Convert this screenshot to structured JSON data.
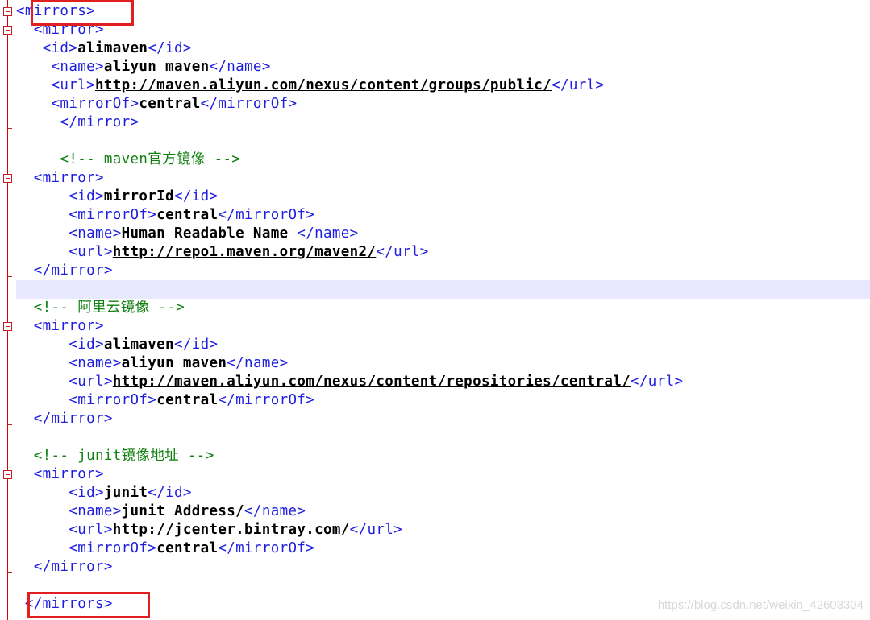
{
  "lines": [
    [
      {
        "t": "<mirrors>",
        "c": "tag"
      }
    ],
    [
      {
        "t": "  <mirror>",
        "c": "tag"
      }
    ],
    [
      {
        "t": "   <id>",
        "c": "tag"
      },
      {
        "t": "alimaven",
        "c": "val"
      },
      {
        "t": "</id>",
        "c": "tag"
      }
    ],
    [
      {
        "t": "    <name>",
        "c": "tag"
      },
      {
        "t": "aliyun maven",
        "c": "val"
      },
      {
        "t": "</name>",
        "c": "tag"
      }
    ],
    [
      {
        "t": "    <url>",
        "c": "tag"
      },
      {
        "t": "http://maven.aliyun.com/nexus/content/groups/public/",
        "c": "url"
      },
      {
        "t": "</url>",
        "c": "tag"
      }
    ],
    [
      {
        "t": "    <mirrorOf>",
        "c": "tag"
      },
      {
        "t": "central",
        "c": "val"
      },
      {
        "t": "</mirrorOf>",
        "c": "tag"
      }
    ],
    [
      {
        "t": "     </mirror>",
        "c": "tag"
      }
    ],
    [],
    [
      {
        "t": "     <!-- maven官方镜像 -->",
        "c": "cmt"
      }
    ],
    [
      {
        "t": "  <mirror>",
        "c": "tag"
      }
    ],
    [
      {
        "t": "      <id>",
        "c": "tag"
      },
      {
        "t": "mirrorId",
        "c": "val"
      },
      {
        "t": "</id>",
        "c": "tag"
      }
    ],
    [
      {
        "t": "      <mirrorOf>",
        "c": "tag"
      },
      {
        "t": "central",
        "c": "val"
      },
      {
        "t": "</mirrorOf>",
        "c": "tag"
      }
    ],
    [
      {
        "t": "      <name>",
        "c": "tag"
      },
      {
        "t": "Human Readable Name ",
        "c": "val"
      },
      {
        "t": "</name>",
        "c": "tag"
      }
    ],
    [
      {
        "t": "      <url>",
        "c": "tag"
      },
      {
        "t": "http://repo1.maven.org/maven2/",
        "c": "url"
      },
      {
        "t": "</url>",
        "c": "tag"
      }
    ],
    [
      {
        "t": "  </mirror>",
        "c": "tag"
      }
    ],
    [],
    [
      {
        "t": "  <!-- 阿里云镜像 -->",
        "c": "cmt"
      }
    ],
    [
      {
        "t": "  <mirror>",
        "c": "tag"
      }
    ],
    [
      {
        "t": "      <id>",
        "c": "tag"
      },
      {
        "t": "alimaven",
        "c": "val"
      },
      {
        "t": "</id>",
        "c": "tag"
      }
    ],
    [
      {
        "t": "      <name>",
        "c": "tag"
      },
      {
        "t": "aliyun maven",
        "c": "val"
      },
      {
        "t": "</name>",
        "c": "tag"
      }
    ],
    [
      {
        "t": "      <url>",
        "c": "tag"
      },
      {
        "t": "http://maven.aliyun.com/nexus/content/repositories/central/",
        "c": "url"
      },
      {
        "t": "</url>",
        "c": "tag"
      }
    ],
    [
      {
        "t": "      <mirrorOf>",
        "c": "tag"
      },
      {
        "t": "central",
        "c": "val"
      },
      {
        "t": "</mirrorOf>",
        "c": "tag"
      }
    ],
    [
      {
        "t": "  </mirror>",
        "c": "tag"
      }
    ],
    [],
    [
      {
        "t": "  <!-- junit镜像地址 -->",
        "c": "cmt"
      }
    ],
    [
      {
        "t": "  <mirror>",
        "c": "tag"
      }
    ],
    [
      {
        "t": "      <id>",
        "c": "tag"
      },
      {
        "t": "junit",
        "c": "val"
      },
      {
        "t": "</id>",
        "c": "tag"
      }
    ],
    [
      {
        "t": "      <name>",
        "c": "tag"
      },
      {
        "t": "junit Address/",
        "c": "val"
      },
      {
        "t": "</name>",
        "c": "tag"
      }
    ],
    [
      {
        "t": "      <url>",
        "c": "tag"
      },
      {
        "t": "http://jcenter.bintray.com/",
        "c": "url"
      },
      {
        "t": "</url>",
        "c": "tag"
      }
    ],
    [
      {
        "t": "      <mirrorOf>",
        "c": "tag"
      },
      {
        "t": "central",
        "c": "val"
      },
      {
        "t": "</mirrorOf>",
        "c": "tag"
      }
    ],
    [
      {
        "t": "  </mirror>",
        "c": "tag"
      }
    ],
    [],
    [
      {
        "t": " </mirrors>",
        "c": "tag"
      }
    ]
  ],
  "current_line": 15,
  "fold_markers": [
    0,
    1,
    9,
    17,
    25
  ],
  "highlighted_lines": [
    0,
    32
  ],
  "watermark": "https://blog.csdn.net/weixin_42603304",
  "colors": {
    "tag": "#1f1fe0",
    "value": "#000000",
    "comment": "#108010",
    "fold_marker": "#c02020",
    "highlight_box": "#e02020",
    "current_line_bg": "#e8e8ff"
  }
}
